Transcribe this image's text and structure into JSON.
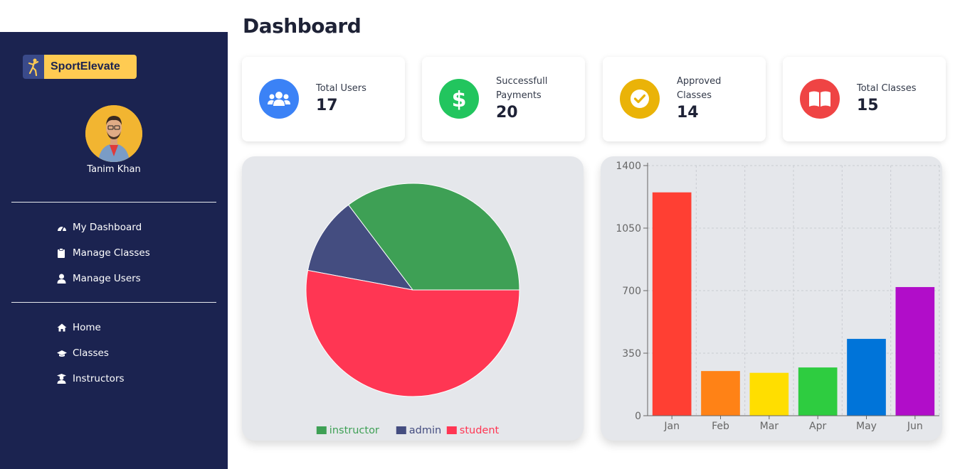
{
  "app": {
    "brand": "SportElevate",
    "user_name": "Tanim Khan"
  },
  "header": {
    "title": "Dashboard"
  },
  "sidebar": {
    "items": [
      {
        "label": "My Dashboard",
        "icon": "gauge-icon"
      },
      {
        "label": "Manage Classes",
        "icon": "clipboard-icon"
      },
      {
        "label": "Manage Users",
        "icon": "user-icon"
      },
      {
        "label": "Home",
        "icon": "home-icon"
      },
      {
        "label": "Classes",
        "icon": "graduation-cap-icon"
      },
      {
        "label": "Instructors",
        "icon": "teacher-icon"
      }
    ]
  },
  "stats": [
    {
      "label": "Total Users",
      "value": "17",
      "icon": "users-icon",
      "color": "#3b82f6"
    },
    {
      "label": "Successfull Payments",
      "value": "20",
      "icon": "dollar-icon",
      "color": "#22c55e"
    },
    {
      "label": "Approved Classes",
      "value": "14",
      "icon": "check-circle-icon",
      "color": "#eab308"
    },
    {
      "label": "Total Classes",
      "value": "15",
      "icon": "book-icon",
      "color": "#ef4444"
    }
  ],
  "chart_data": [
    {
      "type": "pie",
      "categories": [
        "instructor",
        "admin",
        "student"
      ],
      "values": [
        6,
        2,
        9
      ],
      "colors": [
        "#3ea055",
        "#444d80",
        "#ff3653"
      ],
      "legend": "bottom"
    },
    {
      "type": "bar",
      "categories": [
        "Jan",
        "Feb",
        "Mar",
        "Apr",
        "May",
        "Jun"
      ],
      "values": [
        1250,
        250,
        240,
        270,
        430,
        720
      ],
      "colors": [
        "#ff3f33",
        "#ff8216",
        "#ffde00",
        "#2ecc40",
        "#0074d9",
        "#b10dc9"
      ],
      "yticks": [
        "0",
        "350",
        "700",
        "1050",
        "1400"
      ],
      "ylim": [
        0,
        1400
      ],
      "grid": true
    }
  ]
}
